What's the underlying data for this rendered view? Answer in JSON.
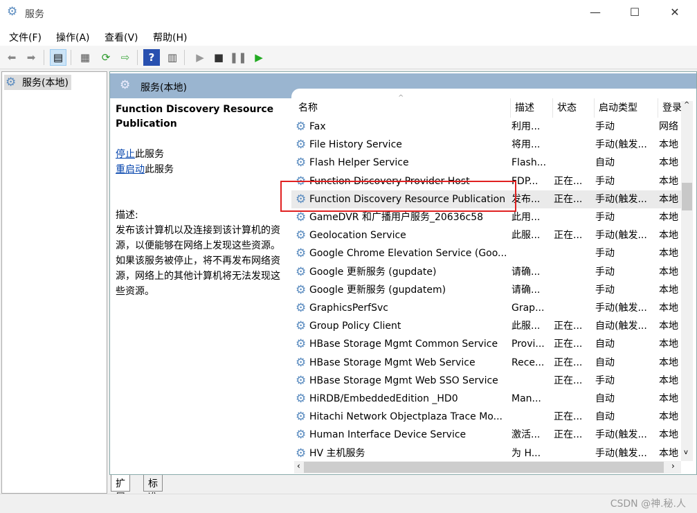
{
  "window": {
    "title": "服务",
    "min": "—",
    "max": "☐",
    "close": "✕"
  },
  "menu": [
    "文件(F)",
    "操作(A)",
    "查看(V)",
    "帮助(H)"
  ],
  "toolbar": {
    "icons": [
      "back-icon",
      "forward-icon",
      "show-hide-tree-icon",
      "properties-icon",
      "refresh-icon",
      "export-list-icon",
      "help-icon",
      "action-pane-icon",
      "start-icon",
      "stop-icon",
      "pause-icon",
      "resume-icon"
    ]
  },
  "tree": {
    "root": "服务(本地)"
  },
  "panel": {
    "title": "服务(本地)"
  },
  "detail": {
    "name": "Function Discovery Resource Publication",
    "stop_link": "停止",
    "stop_suffix": "此服务",
    "restart_link": "重启动",
    "restart_suffix": "此服务",
    "desc_label": "描述:",
    "desc": "发布该计算机以及连接到该计算机的资源，以便能够在网络上发现这些资源。如果该服务被停止，将不再发布网络资源，网络上的其他计算机将无法发现这些资源。"
  },
  "columns": [
    "名称",
    "描述",
    "状态",
    "启动类型",
    "登录"
  ],
  "rows": [
    [
      "Fax",
      "利用...",
      "",
      "手动",
      "网络"
    ],
    [
      "File History Service",
      "将用...",
      "",
      "手动(触发...",
      "本地"
    ],
    [
      "Flash Helper Service",
      "Flash...",
      "",
      "自动",
      "本地"
    ],
    [
      "Function Discovery Provider Host",
      "FDP...",
      "正在...",
      "手动",
      "本地"
    ],
    [
      "Function Discovery Resource Publication",
      "发布...",
      "正在...",
      "手动(触发...",
      "本地"
    ],
    [
      "GameDVR 和广播用户服务_20636c58",
      "此用...",
      "",
      "手动",
      "本地"
    ],
    [
      "Geolocation Service",
      "此服...",
      "正在...",
      "手动(触发...",
      "本地"
    ],
    [
      "Google Chrome Elevation Service (Goo...",
      "",
      "",
      "手动",
      "本地"
    ],
    [
      "Google 更新服务 (gupdate)",
      "请确...",
      "",
      "手动",
      "本地"
    ],
    [
      "Google 更新服务 (gupdatem)",
      "请确...",
      "",
      "手动",
      "本地"
    ],
    [
      "GraphicsPerfSvc",
      "Grap...",
      "",
      "手动(触发...",
      "本地"
    ],
    [
      "Group Policy Client",
      "此服...",
      "正在...",
      "自动(触发...",
      "本地"
    ],
    [
      "HBase Storage Mgmt Common Service",
      "Provi...",
      "正在...",
      "自动",
      "本地"
    ],
    [
      "HBase Storage Mgmt Web Service",
      "Rece...",
      "正在...",
      "自动",
      "本地"
    ],
    [
      "HBase Storage Mgmt Web SSO Service",
      "",
      "正在...",
      "手动",
      "本地"
    ],
    [
      "HiRDB/EmbeddedEdition _HD0",
      "Man...",
      "",
      "自动",
      "本地"
    ],
    [
      "Hitachi Network Objectplaza Trace Mo...",
      "",
      "正在...",
      "自动",
      "本地"
    ],
    [
      "Human Interface Device Service",
      "激活...",
      "正在...",
      "手动(触发...",
      "本地"
    ],
    [
      "HV 主机服务",
      "为 H...",
      "",
      "手动(触发...",
      "本地"
    ]
  ],
  "selected_row": 4,
  "tabs": [
    "扩展",
    "标准"
  ],
  "watermark": "CSDN @神.秘.人",
  "colors": {
    "header_bar": "#9ab5d0",
    "highlight_box": "#e02020",
    "link": "#0645ad"
  }
}
